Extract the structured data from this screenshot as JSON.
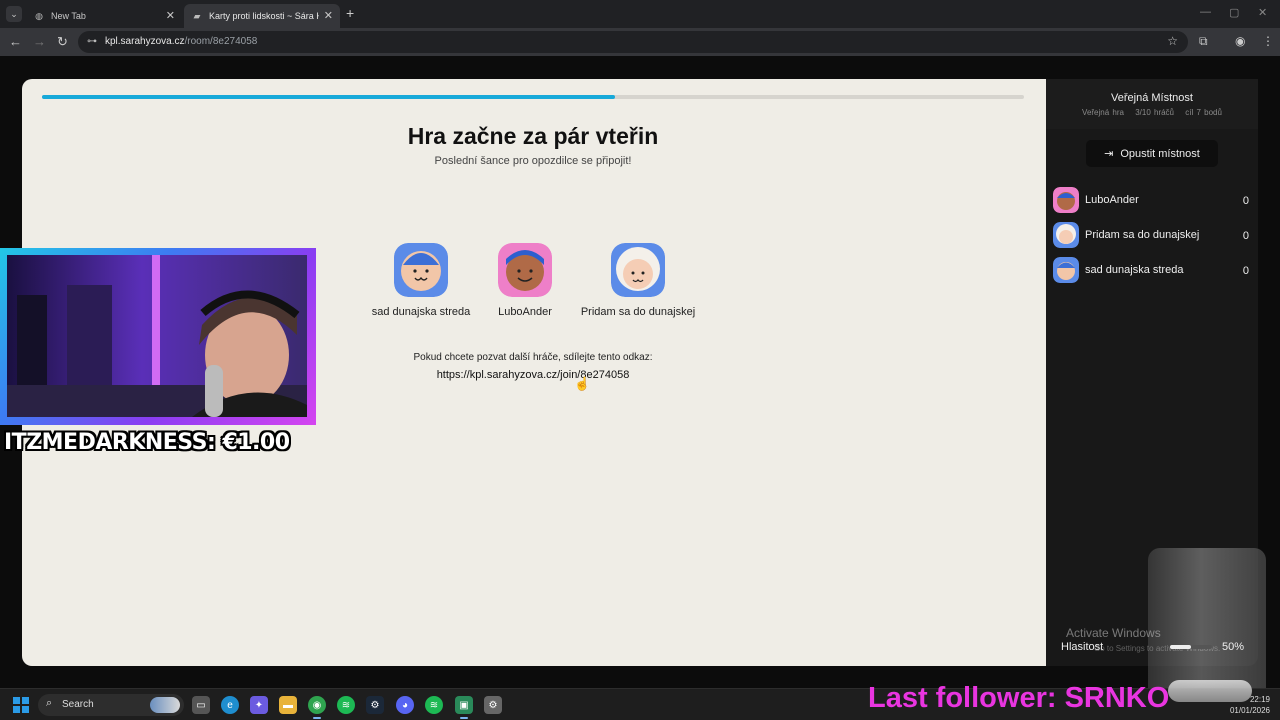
{
  "browser": {
    "tabs": [
      {
        "title": "New Tab",
        "active": false
      },
      {
        "title": "Karty proti lidskosti ~ Sára Hýž",
        "active": true
      }
    ],
    "url_host": "kpl.sarahyzova.cz",
    "url_path": "/room/8e274058"
  },
  "lobby": {
    "progress_fraction": 0.583,
    "headline": "Hra začne za pár vteřin",
    "subline": "Poslední šance pro opozdilce se připojit!",
    "players": [
      {
        "name": "sad dunajska streda",
        "avatar_bg": "#5b8be8"
      },
      {
        "name": "LuboAnder",
        "avatar_bg": "#ee7fc8"
      },
      {
        "name": "Pridam sa do dunajskej",
        "avatar_bg": "#5b8be8"
      }
    ],
    "invite_text": "Pokud chcete pozvat další hráče, sdílejte tento odkaz:",
    "invite_link": "https://kpl.sarahyzova.cz/join/8e274058"
  },
  "sidebar": {
    "title": "Veřejná Místnost",
    "meta": {
      "type": "Veřejná hra",
      "players": "3/10 hráčů",
      "goal": "cíl 7 bodů"
    },
    "leave_label": "Opustit místnost",
    "scores": [
      {
        "name": "LuboAnder",
        "score": "0",
        "avatar_bg": "#ee7fc8"
      },
      {
        "name": "Pridam sa do dunajskej",
        "score": "0",
        "avatar_bg": "#5b8be8"
      },
      {
        "name": "sad dunajska streda",
        "score": "0",
        "avatar_bg": "#5b8be8"
      }
    ]
  },
  "overlay": {
    "donation": "ITZMEDARKNESS: €1.00",
    "last_follower": "Last follower: SRNKO",
    "activate": "Activate Windows",
    "activate_sub": "Go to Settings to activate Windows.",
    "volume_label": "Hlasitost",
    "volume_percent": "50%",
    "volume_fraction": 0.5
  },
  "taskbar": {
    "search_label": "Search",
    "time": "22:19",
    "date": "01/01/2026"
  },
  "colors": {
    "accent": "#17a9d9",
    "card_bg": "#efede6",
    "sidebar_bg": "#181818",
    "follower": "#e935e0"
  }
}
